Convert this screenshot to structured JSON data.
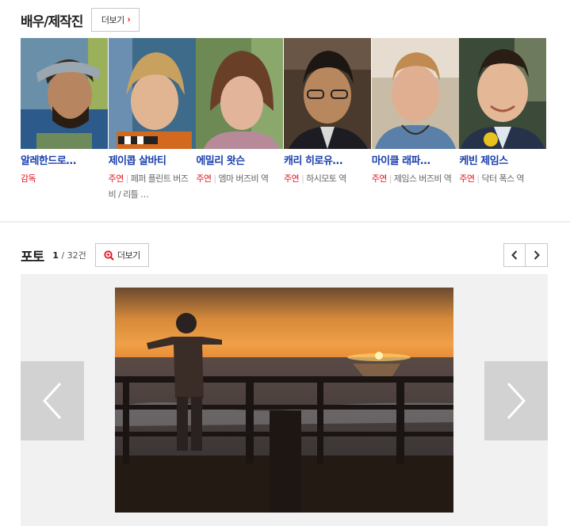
{
  "cast_section": {
    "title": "배우/제작진",
    "more_label": "더보기",
    "items": [
      {
        "name": "알레한드로…",
        "role": "감독",
        "character": ""
      },
      {
        "name": "제이콥 살바티",
        "role": "주연",
        "character": "페퍼 플린트 버즈비 / 리틀 …"
      },
      {
        "name": "에밀리 왓슨",
        "role": "주연",
        "character": "엠마 버즈비 역"
      },
      {
        "name": "캐리 히로유…",
        "role": "주연",
        "character": "하시모토 역"
      },
      {
        "name": "마이클 래파…",
        "role": "주연",
        "character": "제임스 버즈비 역"
      },
      {
        "name": "케빈 제임스",
        "role": "주연",
        "character": "닥터 폭스 역"
      }
    ]
  },
  "photo_section": {
    "title": "포토",
    "current": "1",
    "total": "/ 32건",
    "more_label": "더보기"
  },
  "icons": {
    "more_arrow": "chevron-right-icon",
    "photo_more": "zoom-icon",
    "prev": "chevron-left-icon",
    "next": "chevron-right-icon"
  },
  "colors": {
    "accent": "#e1141e",
    "name_link": "#1a3fae"
  }
}
